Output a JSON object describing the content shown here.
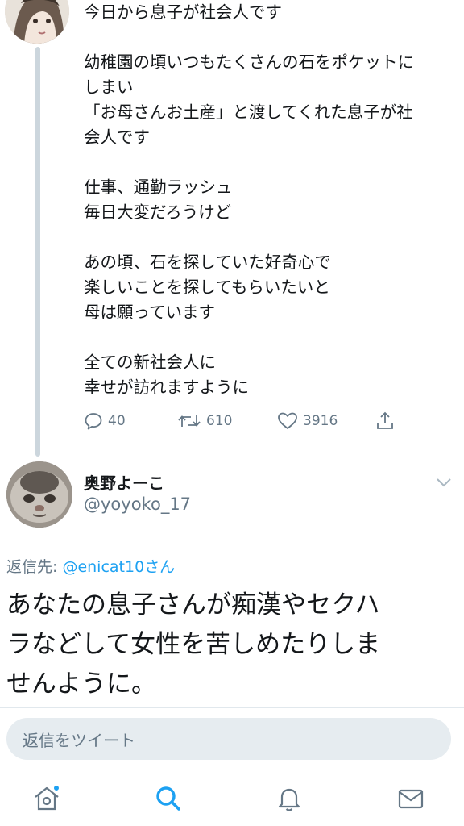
{
  "tweet": {
    "lines": [
      "今日から息子が社会人です",
      "",
      "幼稚園の頃いつもたくさんの石をポケットに",
      "しまい",
      "「お母さんお土産」と渡してくれた息子が社",
      "会人です",
      "",
      "仕事、通勤ラッシュ",
      "毎日大変だろうけど",
      "",
      "あの頃、石を探していた好奇心で",
      "楽しいことを探してもらいたいと",
      "母は願っています",
      "",
      "全ての新社会人に",
      "幸せが訪れますように"
    ],
    "reply_count": "40",
    "retweet_count": "610",
    "like_count": "3916"
  },
  "reply": {
    "display_name": "奥野よーこ",
    "handle": "@yoyoko_17",
    "replying_prefix": "返信先: ",
    "replying_to": "@enicat10さん",
    "lines": [
      "あなたの息子さんが痴漢やセクハ",
      "ラなどして女性を苦しめたりしま",
      "せんように。"
    ]
  },
  "composer": {
    "placeholder": "返信をツイート"
  },
  "icons": {
    "reply": "comment-icon",
    "retweet": "retweet-icon",
    "like": "heart-icon",
    "share": "share-icon",
    "more": "chevron-down-icon",
    "home": "home-icon",
    "search": "search-icon",
    "notifications": "bell-icon",
    "messages": "mail-icon"
  },
  "colors": {
    "accent": "#1da1f2",
    "muted": "#657786",
    "text": "#14171a",
    "thread_line": "#ccd6dd",
    "input_bg": "#e6ecf0"
  }
}
